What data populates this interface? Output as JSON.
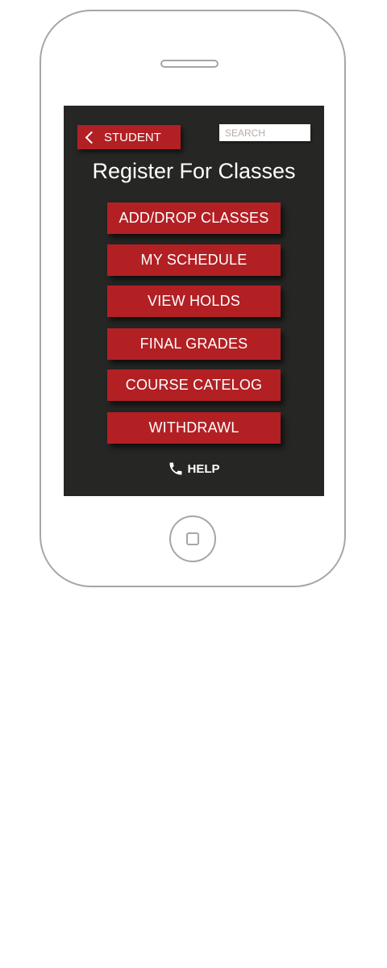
{
  "header": {
    "back_label": "STUDENT",
    "search_placeholder": "SEARCH"
  },
  "page": {
    "title": "Register For Classes"
  },
  "menu": {
    "items": [
      {
        "label": "ADD/DROP CLASSES"
      },
      {
        "label": "MY SCHEDULE"
      },
      {
        "label": "VIEW HOLDS"
      },
      {
        "label": "FINAL GRADES"
      },
      {
        "label": "COURSE CATELOG"
      },
      {
        "label": "WITHDRAWL"
      }
    ]
  },
  "footer": {
    "help_label": "HELP",
    "help_icon": "phone-icon"
  },
  "colors": {
    "screen_background": "#262624",
    "accent_red": "#b22024",
    "device_outline": "#a8a6a2"
  }
}
